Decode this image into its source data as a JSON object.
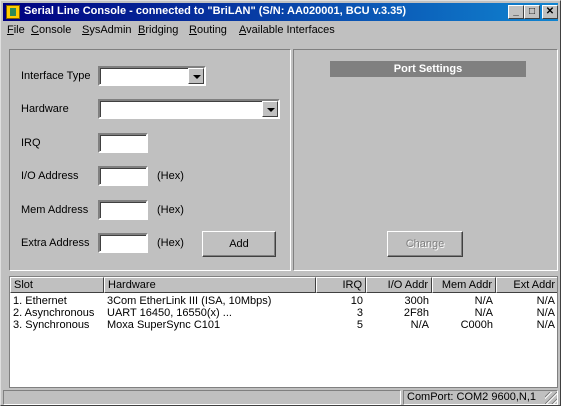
{
  "window": {
    "title": "Serial Line Console - connected to \"BriLAN\" (S/N: AA020001, BCU v.3.35)",
    "minimize_glyph": "_",
    "maximize_glyph": "□",
    "close_glyph": "✕"
  },
  "menu": [
    {
      "first": "F",
      "rest": "ile"
    },
    {
      "first": "C",
      "rest": "onsole"
    },
    {
      "first": "S",
      "rest": "ysAdmin"
    },
    {
      "first": "B",
      "rest": "ridging"
    },
    {
      "first": "R",
      "rest": "outing"
    },
    {
      "first": "A",
      "rest": "vailable Interfaces"
    }
  ],
  "form": {
    "interface_type_label": "Interface Type",
    "interface_type_value": "",
    "hardware_label": "Hardware",
    "hardware_value": "",
    "irq_label": "IRQ",
    "irq_value": "",
    "io_label": "I/O Address",
    "io_value": "",
    "io_hex": "(Hex)",
    "mem_label": "Mem Address",
    "mem_value": "",
    "mem_hex": "(Hex)",
    "extra_label": "Extra Address",
    "extra_value": "",
    "extra_hex": "(Hex)",
    "add_label": "Add"
  },
  "port_settings": {
    "header": "Port Settings",
    "change_label": "Change"
  },
  "table": {
    "columns": [
      "Slot",
      "Hardware",
      "IRQ",
      "I/O Addr",
      "Mem Addr",
      "Ext Addr"
    ],
    "rows": [
      [
        "1. Ethernet",
        "3Com EtherLink III (ISA, 10Mbps)",
        "10",
        "300h",
        "N/A",
        "N/A"
      ],
      [
        "2. Asynchronous",
        "UART 16450, 16550(x) ...",
        "3",
        "2F8h",
        "N/A",
        "N/A"
      ],
      [
        "3. Synchronous",
        "Moxa SuperSync C101",
        "5",
        "N/A",
        "C000h",
        "N/A"
      ]
    ]
  },
  "status": {
    "left": "",
    "comport": "ComPort: COM2 9600,N,1"
  }
}
